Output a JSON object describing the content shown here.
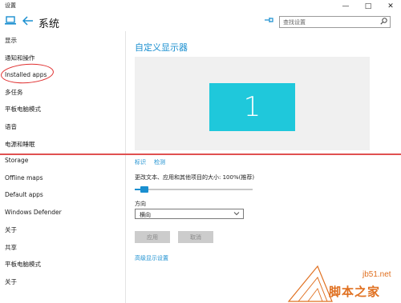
{
  "window": {
    "app_title": "设置",
    "minimize_glyph": "—",
    "maximize_glyph": "□",
    "close_glyph": "✕"
  },
  "header": {
    "home_icon": "monitor-icon",
    "back_icon": "back-arrow-icon",
    "title": "系统",
    "pin_icon": "pin-icon",
    "search_placeholder": "查找设置",
    "search_value": ""
  },
  "sidebar": {
    "items_top": [
      {
        "label": "显示"
      },
      {
        "label": "通知和操作"
      },
      {
        "label": "Installed apps"
      },
      {
        "label": "多任务"
      },
      {
        "label": "平板电脑模式"
      },
      {
        "label": "语音"
      },
      {
        "label": "电源和睡眠"
      }
    ],
    "items_bottom": [
      {
        "label": "Storage"
      },
      {
        "label": "Offline maps"
      },
      {
        "label": "Default apps"
      },
      {
        "label": "Windows Defender"
      },
      {
        "label": "关于"
      },
      {
        "label": "共享"
      },
      {
        "label": "平板电脑模式"
      },
      {
        "label": "关于"
      }
    ]
  },
  "main": {
    "section_title": "自定义显示器",
    "monitor_number": "1",
    "identify_link": "标识",
    "detect_link": "检测",
    "scale_label": "更改文本、应用和其他项目的大小: 100%(推荐)",
    "scale_slider_fraction": 0.05,
    "orientation_label": "方向",
    "orientation_value": "横向",
    "apply_button": "应用",
    "cancel_button": "取消",
    "advanced_link": "高级显示设置"
  },
  "watermark": {
    "url": "jb51.net",
    "name": "脚本之家"
  },
  "colors": {
    "accent": "#1a8fd0",
    "monitor_tile": "#1fc8db",
    "annotation_red": "#e03030",
    "watermark_orange": "#e07020"
  }
}
